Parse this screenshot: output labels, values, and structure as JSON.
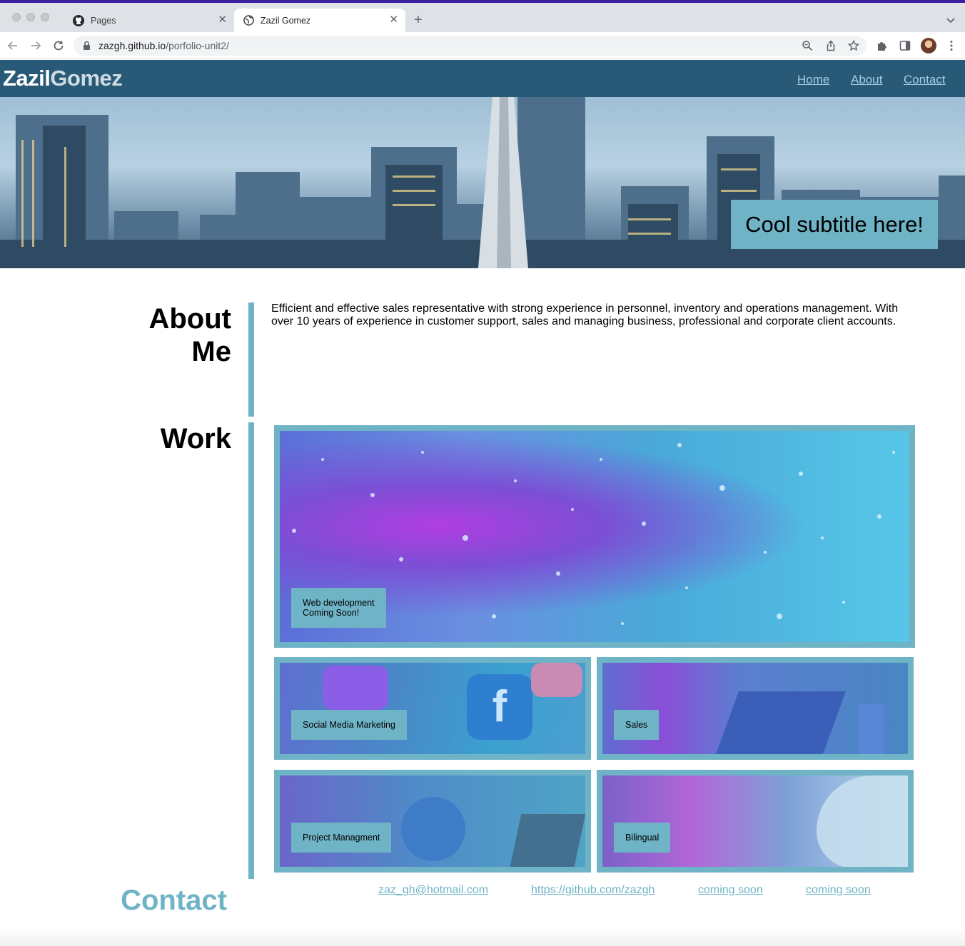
{
  "browser": {
    "tabs": [
      {
        "title": "Pages",
        "icon": "github-icon",
        "active": false
      },
      {
        "title": "Zazil Gomez",
        "icon": "globe-icon",
        "active": true
      }
    ],
    "url_host": "zazgh.github.io",
    "url_path": "/porfolio-unit2/"
  },
  "site": {
    "brand_first": "Zazil",
    "brand_last": "Gomez",
    "nav": [
      "Home",
      "About",
      "Contact"
    ],
    "subtitle": "Cool subtitle here!"
  },
  "about": {
    "title_line1": "About",
    "title_line2": "Me",
    "text": "Efficient and effective sales representative with strong experience in personnel, inventory and operations management. With over 10 years of experience in customer support, sales and managing business, professional and corporate client accounts."
  },
  "work": {
    "title": "Work",
    "featured_line1": "Web development",
    "featured_line2": "Coming Soon!",
    "items": [
      "Social Media Marketing",
      "Sales",
      "Project Managment",
      "Bilingual"
    ]
  },
  "contact": {
    "title": "Contact",
    "links": [
      "zaz_gh@hotmail.com",
      "https://github.com/zazgh",
      "coming soon",
      "coming soon"
    ]
  },
  "colors": {
    "header_bg": "#285a78",
    "accent": "#6fb3c6",
    "nav_link": "#9fd0e4"
  }
}
